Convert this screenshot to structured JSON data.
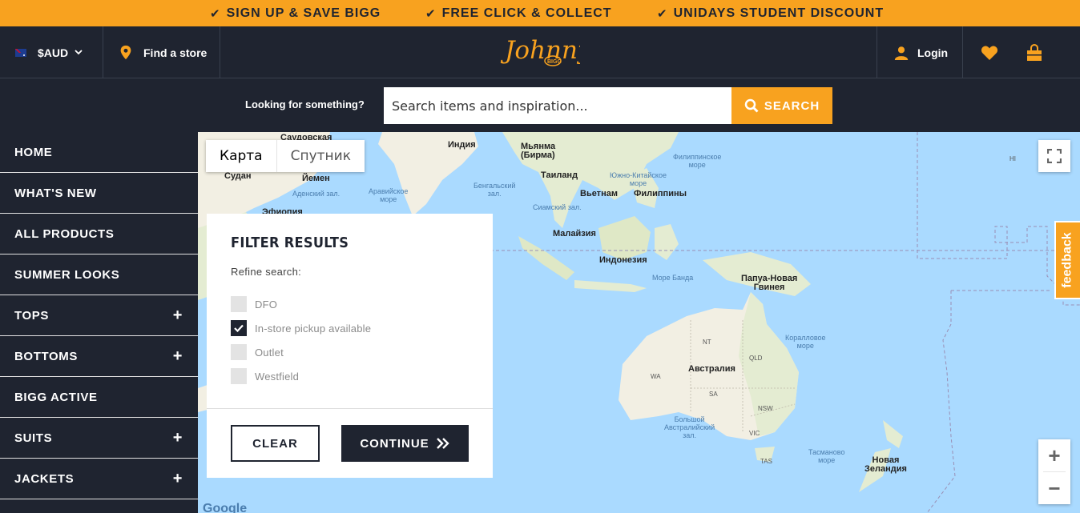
{
  "promo": [
    {
      "icon": "check-icon",
      "text": "SIGN UP & SAVE BIGG"
    },
    {
      "icon": "check-icon",
      "text": "FREE CLICK & COLLECT"
    },
    {
      "icon": "check-icon",
      "text": "UNIDAYS STUDENT DISCOUNT"
    }
  ],
  "header": {
    "currency": "$AUD",
    "find_store": "Find a store",
    "logo_text": "Johnny",
    "logo_sub": "BIGG",
    "login": "Login"
  },
  "search": {
    "label": "Looking for something?",
    "placeholder": "Search items and inspiration...",
    "button": "SEARCH"
  },
  "nav": [
    {
      "label": "HOME",
      "expandable": false
    },
    {
      "label": "WHAT'S NEW",
      "expandable": false
    },
    {
      "label": "ALL PRODUCTS",
      "expandable": false
    },
    {
      "label": "SUMMER LOOKS",
      "expandable": false
    },
    {
      "label": "TOPS",
      "expandable": true
    },
    {
      "label": "BOTTOMS",
      "expandable": true
    },
    {
      "label": "BIGG ACTIVE",
      "expandable": false
    },
    {
      "label": "SUITS",
      "expandable": true
    },
    {
      "label": "JACKETS",
      "expandable": true
    }
  ],
  "map": {
    "tab_map": "Карта",
    "tab_satellite": "Спутник",
    "labels": {
      "saudi": "Саудовская",
      "india": "Индия",
      "myanmar": "Мьянма\n(Бирма)",
      "sudan": "Судан",
      "yemen": "Йемен",
      "aden": "Аденский зал.",
      "ethiopia": "Эфиопия",
      "arabian_sea": "Аравийское\nморе",
      "bengal": "Бенгальский\nзал.",
      "thailand": "Таиланд",
      "scs": "Южно-Китайское\nморе",
      "vietnam": "Вьетнам",
      "philippines": "Филиппины",
      "phil_sea": "Филиппинское\nморе",
      "siam": "Сиамский зал.",
      "malaysia": "Малайзия",
      "indonesia": "Индонезия",
      "banda": "Море Банда",
      "png": "Папуа-Новая\nГвинея",
      "coral": "Коралловое\nморе",
      "australia": "Австралия",
      "nt": "NT",
      "qld": "QLD",
      "wa": "WA",
      "sa": "SA",
      "nsw": "NSW",
      "vic": "VIC",
      "tas": "TAS",
      "gab": "Большой\nАвстралийский\nзал.",
      "tasman": "Тасманово\nморе",
      "nz": "Новая\nЗеландия",
      "hi": "HI",
      "google": "Google"
    }
  },
  "feedback": "feedback",
  "filter": {
    "title": "FILTER RESULTS",
    "refine": "Refine search:",
    "options": [
      {
        "label": "DFO",
        "checked": false
      },
      {
        "label": "In-store pickup available",
        "checked": true
      },
      {
        "label": "Outlet",
        "checked": false
      },
      {
        "label": "Westfield",
        "checked": false
      }
    ],
    "clear": "CLEAR",
    "continue": "CONTINUE"
  },
  "colors": {
    "accent": "#f8a21f",
    "dark": "#1f2430",
    "water": "#aadaff",
    "land": "#f2efe3"
  }
}
